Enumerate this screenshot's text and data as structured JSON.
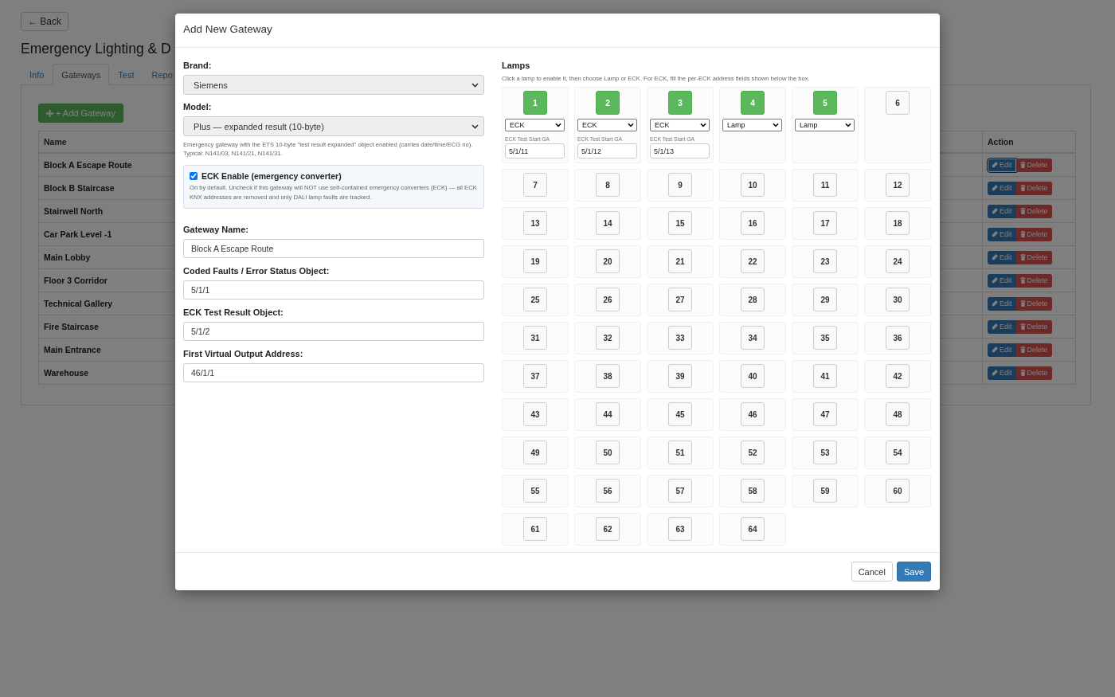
{
  "page": {
    "back": "← Back",
    "title": "Emergency Lighting & D",
    "tabs": [
      {
        "label": "Info",
        "selected": false
      },
      {
        "label": "Gateways",
        "selected": true
      },
      {
        "label": "Test",
        "selected": false
      },
      {
        "label": "Repo",
        "selected": false
      }
    ],
    "add_button": "+ Add Gateway",
    "table": {
      "columns": [
        "Name",
        "Action"
      ],
      "rows": [
        {
          "name": "Block A Escape Route",
          "edit": "Edit",
          "delete": "Delete",
          "focused": true
        },
        {
          "name": "Block B Staircase",
          "edit": "Edit",
          "delete": "Delete",
          "focused": false
        },
        {
          "name": "Stairwell North",
          "edit": "Edit",
          "delete": "Delete",
          "focused": false
        },
        {
          "name": "Car Park Level -1",
          "edit": "Edit",
          "delete": "Delete",
          "focused": false
        },
        {
          "name": "Main Lobby",
          "edit": "Edit",
          "delete": "Delete",
          "focused": false
        },
        {
          "name": "Floor 3 Corridor",
          "edit": "Edit",
          "delete": "Delete",
          "focused": false
        },
        {
          "name": "Technical Gallery",
          "edit": "Edit",
          "delete": "Delete",
          "focused": false
        },
        {
          "name": "Fire Staircase",
          "edit": "Edit",
          "delete": "Delete",
          "focused": false
        },
        {
          "name": "Main Entrance",
          "edit": "Edit",
          "delete": "Delete",
          "focused": false
        },
        {
          "name": "Warehouse",
          "edit": "Edit",
          "delete": "Delete",
          "focused": false
        }
      ]
    }
  },
  "modal": {
    "title": "Add New Gateway",
    "brand": {
      "label": "Brand:",
      "value": "Siemens"
    },
    "model": {
      "label": "Model:",
      "value": "Plus — expanded result (10-byte)",
      "help": "Emergency gateway with the ETS 10-byte \"test result expanded\" object enabled (carries date/time/ECG no). Typical: N141/03, N141/21, N141/31."
    },
    "eck": {
      "label": "ECK Enable (emergency converter)",
      "checked": true,
      "help": "On by default. Uncheck if this gateway will NOT use self-contained emergency converters (ECK) — all ECK KNX addresses are removed and only DALI lamp faults are tracked."
    },
    "fields": [
      {
        "label": "Gateway Name:",
        "value": "Block A Escape Route"
      },
      {
        "label": "Coded Faults / Error Status Object:",
        "value": "5/1/1"
      },
      {
        "label": "ECK Test Result Object:",
        "value": "5/1/2"
      },
      {
        "label": "First Virtual Output Address:",
        "value": "46/1/1"
      }
    ],
    "lamps": {
      "title": "Lamps",
      "hint": "Click a lamp to enable it, then choose Lamp or ECK. For ECK, fill the per-ECK address fields shown below the box.",
      "items": [
        {
          "number": "1",
          "enabled": true,
          "type": "ECK",
          "ga_label": "ECK Test Start GA",
          "ga_value": "5/1/11"
        },
        {
          "number": "2",
          "enabled": true,
          "type": "ECK",
          "ga_label": "ECK Test Start GA",
          "ga_value": "5/1/12"
        },
        {
          "number": "3",
          "enabled": true,
          "type": "ECK",
          "ga_label": "ECK Test Start GA",
          "ga_value": "5/1/13"
        },
        {
          "number": "4",
          "enabled": true,
          "type": "Lamp"
        },
        {
          "number": "5",
          "enabled": true,
          "type": "Lamp"
        },
        {
          "number": "6",
          "enabled": false
        },
        {
          "number": "7",
          "enabled": false
        },
        {
          "number": "8",
          "enabled": false
        },
        {
          "number": "9",
          "enabled": false
        },
        {
          "number": "10",
          "enabled": false
        },
        {
          "number": "11",
          "enabled": false
        },
        {
          "number": "12",
          "enabled": false
        },
        {
          "number": "13",
          "enabled": false
        },
        {
          "number": "14",
          "enabled": false
        },
        {
          "number": "15",
          "enabled": false
        },
        {
          "number": "16",
          "enabled": false
        },
        {
          "number": "17",
          "enabled": false
        },
        {
          "number": "18",
          "enabled": false
        },
        {
          "number": "19",
          "enabled": false
        },
        {
          "number": "20",
          "enabled": false
        },
        {
          "number": "21",
          "enabled": false
        },
        {
          "number": "22",
          "enabled": false
        },
        {
          "number": "23",
          "enabled": false
        },
        {
          "number": "24",
          "enabled": false
        },
        {
          "number": "25",
          "enabled": false
        },
        {
          "number": "26",
          "enabled": false
        },
        {
          "number": "27",
          "enabled": false
        },
        {
          "number": "28",
          "enabled": false
        },
        {
          "number": "29",
          "enabled": false
        },
        {
          "number": "30",
          "enabled": false
        },
        {
          "number": "31",
          "enabled": false
        },
        {
          "number": "32",
          "enabled": false
        },
        {
          "number": "33",
          "enabled": false
        },
        {
          "number": "34",
          "enabled": false
        },
        {
          "number": "35",
          "enabled": false
        },
        {
          "number": "36",
          "enabled": false
        },
        {
          "number": "37",
          "enabled": false
        },
        {
          "number": "38",
          "enabled": false
        },
        {
          "number": "39",
          "enabled": false
        },
        {
          "number": "40",
          "enabled": false
        },
        {
          "number": "41",
          "enabled": false
        },
        {
          "number": "42",
          "enabled": false
        },
        {
          "number": "43",
          "enabled": false
        },
        {
          "number": "44",
          "enabled": false
        },
        {
          "number": "45",
          "enabled": false
        },
        {
          "number": "46",
          "enabled": false
        },
        {
          "number": "47",
          "enabled": false
        },
        {
          "number": "48",
          "enabled": false
        },
        {
          "number": "49",
          "enabled": false
        },
        {
          "number": "50",
          "enabled": false
        },
        {
          "number": "51",
          "enabled": false
        },
        {
          "number": "52",
          "enabled": false
        },
        {
          "number": "53",
          "enabled": false
        },
        {
          "number": "54",
          "enabled": false
        },
        {
          "number": "55",
          "enabled": false
        },
        {
          "number": "56",
          "enabled": false
        },
        {
          "number": "57",
          "enabled": false
        },
        {
          "number": "58",
          "enabled": false
        },
        {
          "number": "59",
          "enabled": false
        },
        {
          "number": "60",
          "enabled": false
        },
        {
          "number": "61",
          "enabled": false
        },
        {
          "number": "62",
          "enabled": false
        },
        {
          "number": "63",
          "enabled": false
        },
        {
          "number": "64",
          "enabled": false
        }
      ]
    },
    "buttons": [
      {
        "label": "Cancel",
        "kind": "default"
      },
      {
        "label": "Save",
        "kind": "primary"
      }
    ]
  }
}
